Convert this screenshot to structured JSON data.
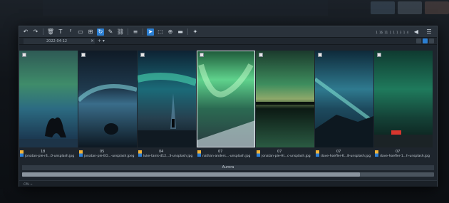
{
  "window": {
    "tab_title": "2022-04-12",
    "tab_close": "×",
    "tab_add": "+ ▾",
    "toolbar_right_text": "1 16 11 1 1 1 3 1 4",
    "status_text": "CPU ~",
    "group_label": "Aurora",
    "scroll_fraction": 0.82,
    "accent": "#2b7fd3"
  },
  "toolbar": {
    "icons": [
      "undo-icon",
      "redo-icon",
      "trash-icon",
      "text-icon",
      "text-format-icon",
      "caption-icon",
      "link-icon",
      "rotate-icon",
      "brush-icon",
      "crop-icon",
      "rows-icon",
      "cursor-icon",
      "select-icon",
      "select-plus-icon",
      "display-icon",
      "magic-icon"
    ]
  },
  "photos": [
    {
      "num": "18",
      "name": "jonatan-pie-r4...0-unsplash.jpg",
      "selected": false
    },
    {
      "num": "05",
      "name": "jonatan-pie-EO...-unsplash.jpeg",
      "selected": false
    },
    {
      "num": "04",
      "name": "luke-tanis-d12...3-unsplash.jpg",
      "selected": false
    },
    {
      "num": "07",
      "name": "nathan-anders...-unsplash.jpg",
      "selected": true
    },
    {
      "num": "07",
      "name": "jonatan-pie-Hi...c-unsplash.jpg",
      "selected": false
    },
    {
      "num": "07",
      "name": "dave-hoefler-K...8-unsplash.jpg",
      "selected": false
    },
    {
      "num": "07",
      "name": "dave-hoefler-1...h-unsplash.jpg",
      "selected": false
    }
  ]
}
